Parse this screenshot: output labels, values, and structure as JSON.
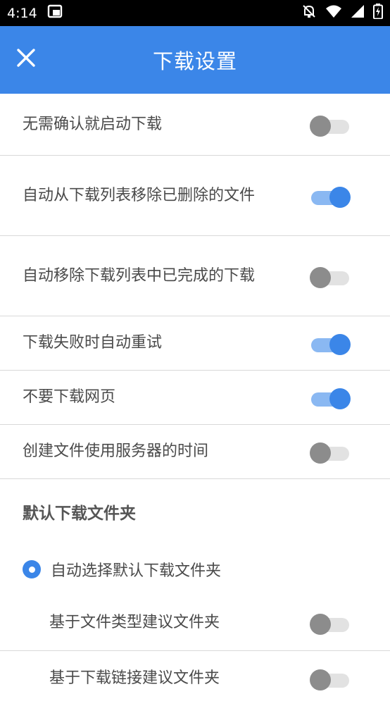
{
  "status_bar": {
    "time": "4:14"
  },
  "app_bar": {
    "title": "下载设置"
  },
  "settings": [
    {
      "label": "无需确认就启动下载",
      "enabled": false
    },
    {
      "label": "自动从下载列表移除已删除的文件",
      "enabled": true
    },
    {
      "label": "自动移除下载列表中已完成的下载",
      "enabled": false
    },
    {
      "label": "下载失败时自动重试",
      "enabled": true
    },
    {
      "label": "不要下载网页",
      "enabled": true
    },
    {
      "label": "创建文件使用服务器的时间",
      "enabled": false
    }
  ],
  "default_folder": {
    "header": "默认下载文件夹",
    "radio_option": {
      "label": "自动选择默认下载文件夹",
      "selected": true
    },
    "sub_settings": [
      {
        "label": "基于文件类型建议文件夹",
        "enabled": false
      },
      {
        "label": "基于下载链接建议文件夹",
        "enabled": false
      }
    ]
  },
  "colors": {
    "accent": "#3b86e8",
    "status_bar": "#000000"
  }
}
